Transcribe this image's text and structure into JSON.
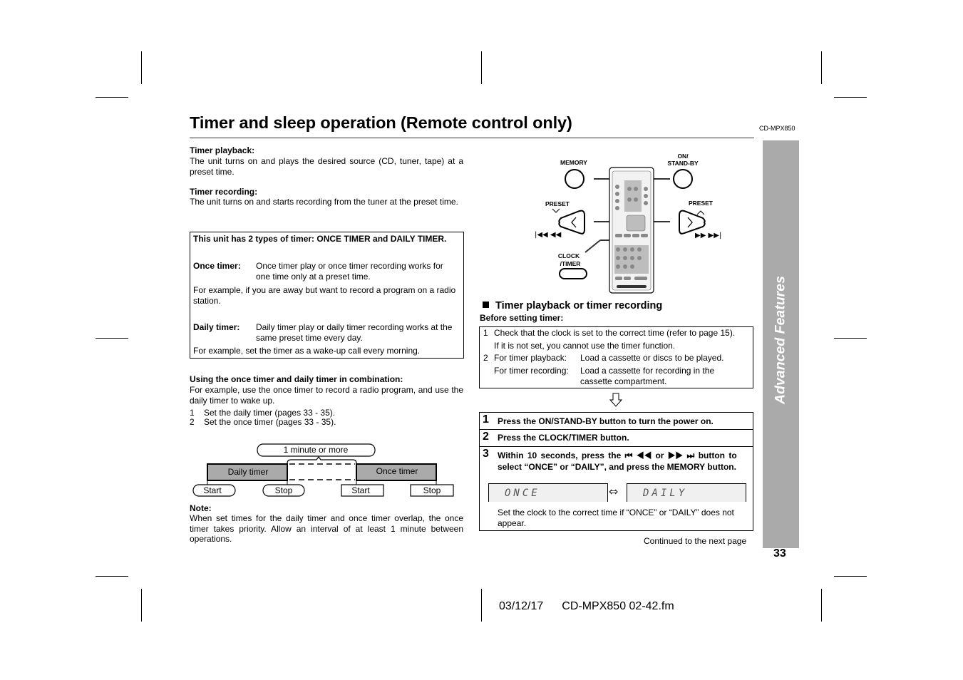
{
  "header": {
    "title": "Timer and sleep operation (Remote control only)",
    "model": "CD-MPX850"
  },
  "side_tab": {
    "label": "Advanced Features",
    "color": "#aaaaaa"
  },
  "page_number": "33",
  "footer": {
    "date": "03/12/17",
    "file": "CD-MPX850 02-42.fm"
  },
  "left": {
    "playback": {
      "heading": "Timer playback:",
      "text": "The unit turns on and plays the desired source (CD, tuner, tape) at a preset time."
    },
    "recording": {
      "heading": "Timer recording:",
      "text": "The unit turns on and starts recording from the tuner at the preset time."
    },
    "types_box": {
      "heading": "This unit has 2 types of timer: ONCE TIMER and DAILY TIMER.",
      "once_label": "Once timer:",
      "once_text": "Once timer play or once timer recording works for one time only at a preset time.",
      "once_example": "For example, if you are away but want to record a program on a radio station.",
      "daily_label": "Daily timer:",
      "daily_text": "Daily timer play or daily timer recording works at the same preset time every day.",
      "daily_example": "For example, set the timer as a wake-up call every morning."
    },
    "combination": {
      "heading": "Using the once timer and daily timer in combination:",
      "text": "For example, use the once timer to record a radio program, and use the daily timer to wake up.",
      "steps": [
        {
          "num": "1",
          "text": "Set the daily timer (pages 33 - 35)."
        },
        {
          "num": "2",
          "text": "Set the once timer (pages 33 - 35)."
        }
      ]
    },
    "diagram": {
      "interval_label": "1 minute or more",
      "daily_label": "Daily timer",
      "once_label": "Once timer",
      "daily_start": "Start",
      "daily_stop": "Stop",
      "once_start": "Start",
      "once_stop": "Stop",
      "fill_color": "#aaaaaa"
    },
    "note": {
      "heading": "Note:",
      "text": "When set times for the daily timer and once timer overlap, the once timer takes priority. Allow an interval of at least 1 minute between operations."
    }
  },
  "remote": {
    "memory_label": "MEMORY",
    "on_label_1": "ON/",
    "on_label_2": "STAND-BY",
    "preset_left": "PRESET",
    "preset_right": "PRESET",
    "rewind_symbols": "◀◀ ◀◀",
    "forward_symbols": "▶▶ ▶▶",
    "clock_label_1": "CLOCK",
    "clock_label_2": "/TIMER"
  },
  "right": {
    "section_heading": "Timer playback or timer recording",
    "before_heading": "Before setting timer:",
    "before_items": [
      {
        "num": "1",
        "line1": "Check that the clock is set to the correct time (refer to page 15).",
        "line2": "If it is not set, you cannot use the timer function."
      },
      {
        "num": "2",
        "label1": "For timer playback:",
        "text1": "Load a cassette or discs to be played.",
        "label2": "For timer recording:",
        "text2a": "Load a cassette for recording in the",
        "text2b": "cassette compartment."
      }
    ],
    "steps": [
      {
        "num": "1",
        "text": "Press the ON/STAND-BY button to turn the power on."
      },
      {
        "num": "2",
        "text": "Press the CLOCK/TIMER button."
      },
      {
        "num": "3",
        "line1": "Within 10 seconds, press the ⏮ ◀◀ or ▶▶ ⏭ button to",
        "line2": "select “ONCE” or “DAILY”, and press the MEMORY button."
      }
    ],
    "display_once": "ONCE",
    "display_daily": "DAILY",
    "display_arrow": "⇔",
    "step3_note": "Set the clock to the correct time if “ONCE” or “DAILY” does not appear.",
    "continued": "Continued to the next page"
  }
}
